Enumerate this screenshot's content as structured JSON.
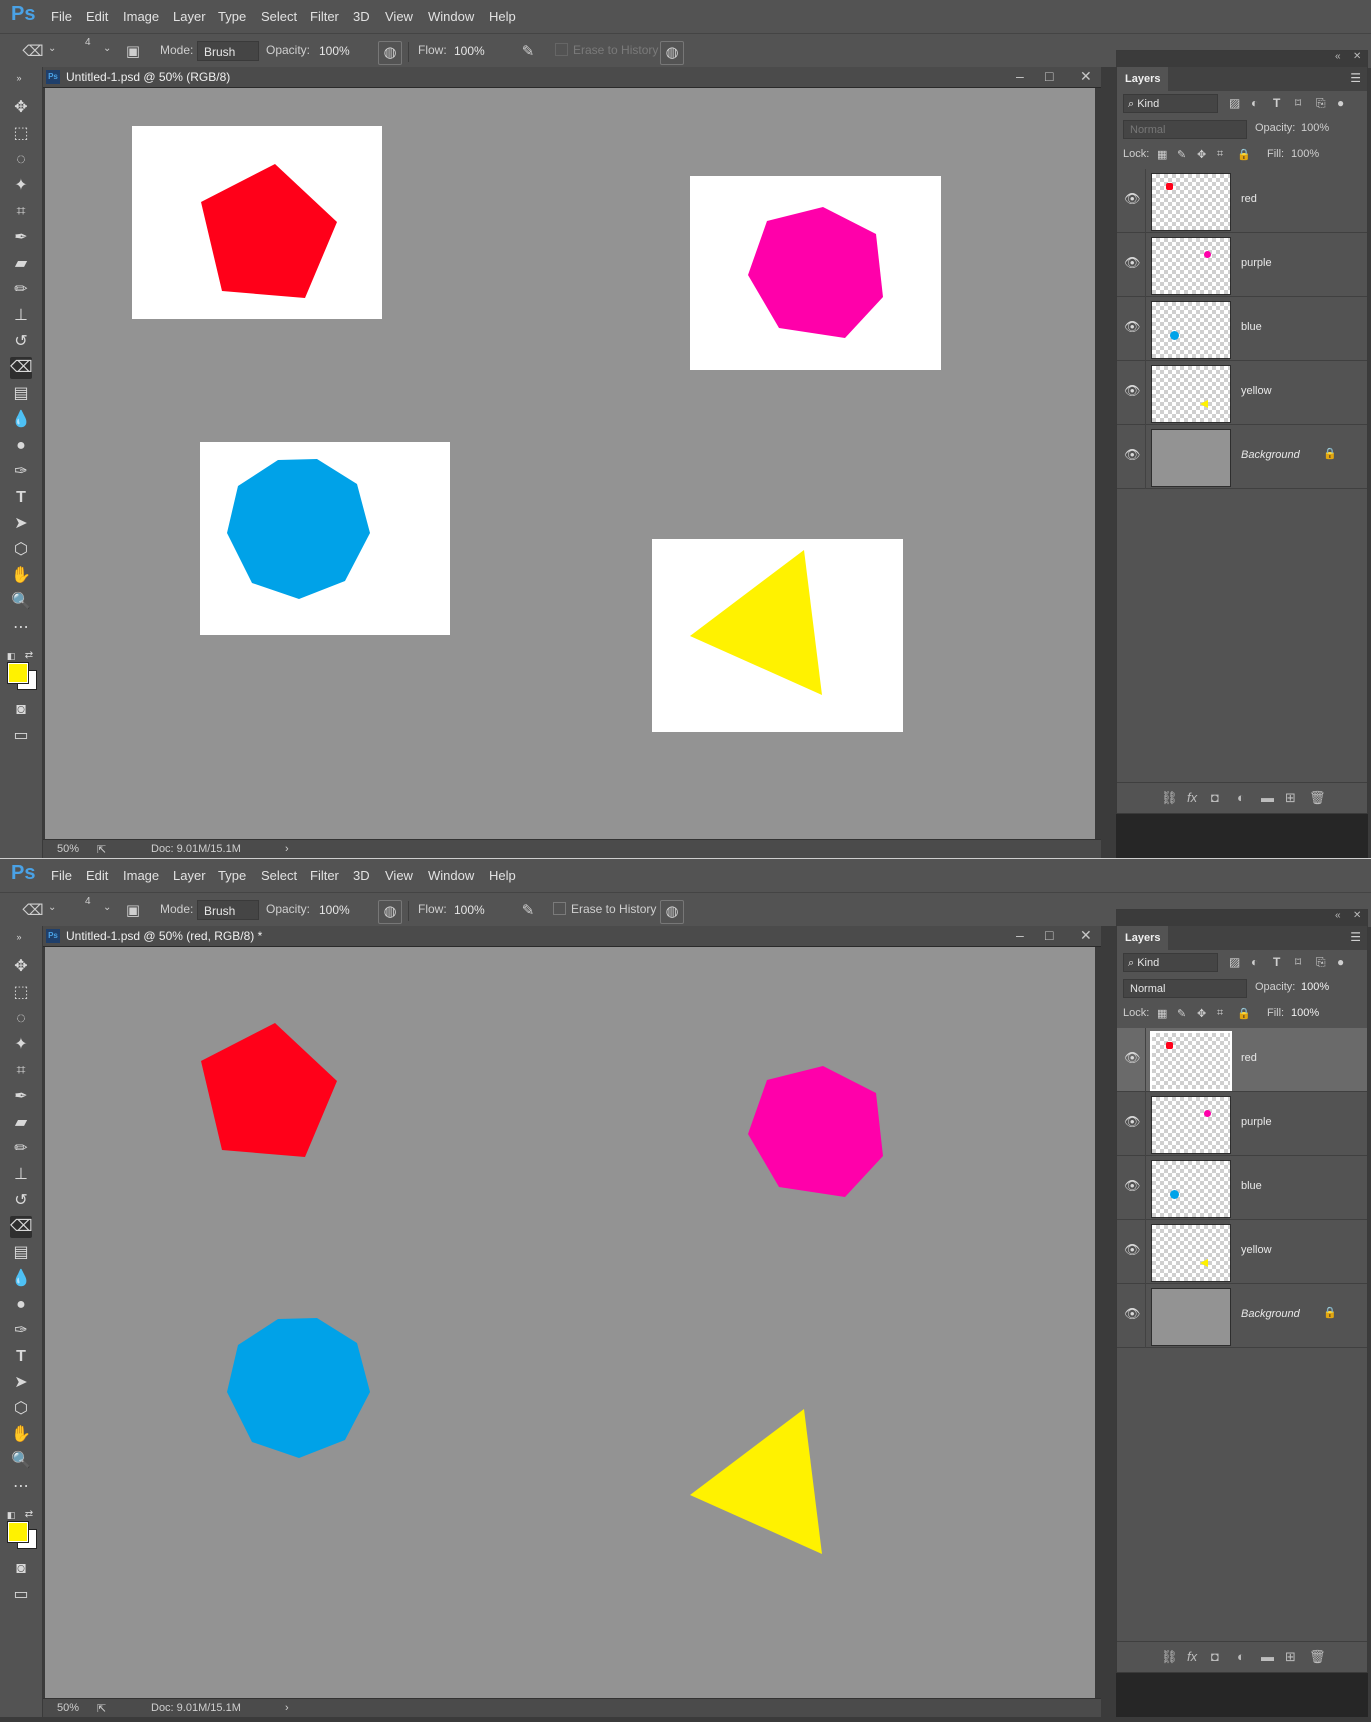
{
  "app": {
    "logo": "Ps",
    "menu": [
      "File",
      "Edit",
      "Image",
      "Layer",
      "Type",
      "Select",
      "Filter",
      "3D",
      "View",
      "Window",
      "Help"
    ]
  },
  "options": {
    "brush_size": "4",
    "mode_label": "Mode:",
    "mode_value": "Brush",
    "opacity_label": "Opacity:",
    "opacity_value": "100%",
    "flow_label": "Flow:",
    "flow_value": "100%",
    "erase_history": "Erase to History"
  },
  "windows": [
    {
      "doc_title": "Untitled-1.psd @ 50% (RGB/8)",
      "zoom": "50%",
      "doc_info": "Doc: 9.01M/15.1M",
      "white_backdrops": true,
      "erase_history_enabled": false,
      "panel_controls_enabled": false,
      "selected_layer": null
    },
    {
      "doc_title": "Untitled-1.psd @ 50% (red, RGB/8) *",
      "zoom": "50%",
      "doc_info": "Doc: 9.01M/15.1M",
      "white_backdrops": false,
      "erase_history_enabled": true,
      "panel_controls_enabled": true,
      "selected_layer": "red"
    }
  ],
  "layers_panel": {
    "title": "Layers",
    "kind": "Kind",
    "blend_mode": "Normal",
    "opacity_label": "Opacity:",
    "opacity_value": "100%",
    "lock_label": "Lock:",
    "fill_label": "Fill:",
    "fill_value": "100%",
    "layers": [
      {
        "name": "red",
        "color": "#ff0019"
      },
      {
        "name": "purple",
        "color": "#ff00aa"
      },
      {
        "name": "blue",
        "color": "#00a2e8"
      },
      {
        "name": "yellow",
        "color": "#fff200"
      },
      {
        "name": "Background",
        "color": "#939393"
      }
    ]
  },
  "colors": {
    "foreground": "#fff200",
    "background": "#ffffff",
    "canvas": "#939393",
    "red": "#ff0019",
    "magenta": "#ff00aa",
    "blue": "#00a2e8",
    "yellow": "#fff200"
  }
}
